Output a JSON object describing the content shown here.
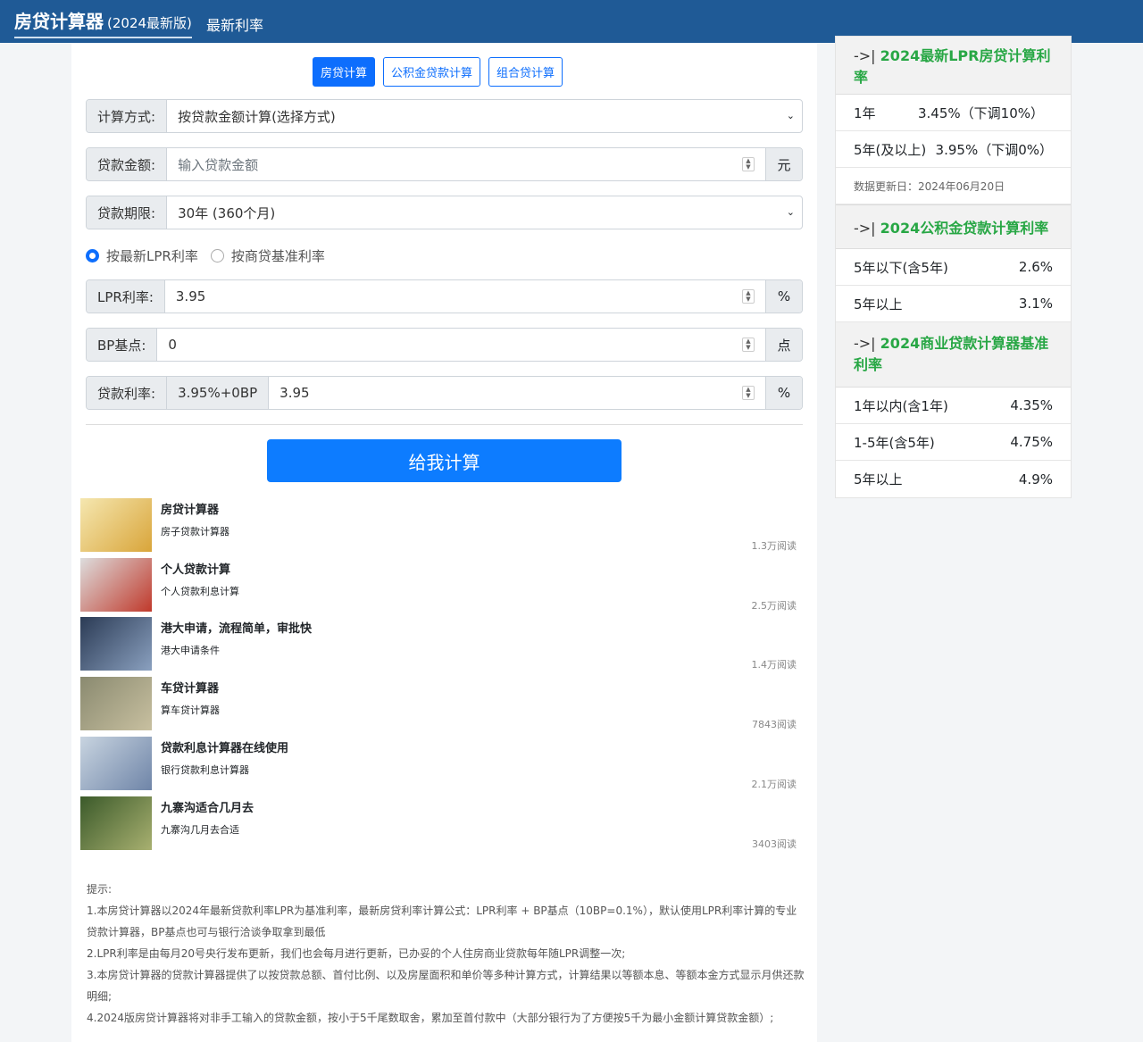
{
  "header": {
    "title": "房贷计算器",
    "version": "(2024最新版)",
    "link": "最新利率"
  },
  "tabs": [
    "房贷计算",
    "公积金贷款计算",
    "组合贷计算"
  ],
  "form": {
    "method_label": "计算方式:",
    "method_value": "按贷款金额计算(选择方式)",
    "amount_label": "贷款金额:",
    "amount_placeholder": "输入贷款金额",
    "amount_unit": "元",
    "term_label": "贷款期限:",
    "term_value": "30年 (360个月)",
    "radio_lpr": "按最新LPR利率",
    "radio_base": "按商贷基准利率",
    "lpr_label": "LPR利率:",
    "lpr_value": "3.95",
    "pct": "%",
    "bp_label": "BP基点:",
    "bp_value": "0",
    "bp_unit": "点",
    "rate_label": "贷款利率:",
    "rate_formula": "3.95%+0BP",
    "rate_value": "3.95",
    "submit": "给我计算"
  },
  "articles": [
    {
      "title": "房贷计算器",
      "sub": "房子贷款计算器",
      "reads": "1.3万阅读"
    },
    {
      "title": "个人贷款计算",
      "sub": "个人贷款利息计算",
      "reads": "2.5万阅读"
    },
    {
      "title": "港大申请，流程简单，审批快",
      "sub": "港大申请条件",
      "reads": "1.4万阅读"
    },
    {
      "title": "车贷计算器",
      "sub": "算车贷计算器",
      "reads": "7843阅读"
    },
    {
      "title": "贷款利息计算器在线使用",
      "sub": "银行贷款利息计算器",
      "reads": "2.1万阅读"
    },
    {
      "title": "九寨沟适合几月去",
      "sub": "九寨沟几月去合适",
      "reads": "3403阅读"
    }
  ],
  "tips": [
    "提示:",
    "1.本房贷计算器以2024年最新贷款利率LPR为基准利率，最新房贷利率计算公式：LPR利率 + BP基点（10BP=0.1%），默认使用LPR利率计算的专业贷款计算器，BP基点也可与银行洽谈争取拿到最低",
    "2.LPR利率是由每月20号央行发布更新，我们也会每月进行更新，已办妥的个人住房商业贷款每年随LPR调整一次;",
    "3.本房贷计算器的贷款计算器提供了以按贷款总额、首付比例、以及房屋面积和单价等多种计算方式，计算结果以等额本息、等额本金方式显示月供还款明细;",
    "4.2024版房贷计算器将对非手工输入的贷款金额，按小于5千尾数取舍，累加至首付款中（大部分银行为了方便按5千为最小金额计算贷款金额）;"
  ],
  "sidebar": {
    "prefix": "->|",
    "lpr": {
      "title": "2024最新LPR房贷计算利率",
      "rows": [
        [
          "1年",
          "3.45%（下调10%）"
        ],
        [
          "5年(及以上)",
          "3.95%（下调0%）"
        ]
      ],
      "note": "数据更新日：2024年06月20日"
    },
    "fund": {
      "title": "2024公积金贷款计算利率",
      "rows": [
        [
          "5年以下(含5年)",
          "2.6%"
        ],
        [
          "5年以上",
          "3.1%"
        ]
      ]
    },
    "biz": {
      "title": "2024商业贷款计算器基准利率",
      "rows": [
        [
          "1年以内(含1年)",
          "4.35%"
        ],
        [
          "1-5年(含5年)",
          "4.75%"
        ],
        [
          "5年以上",
          "4.9%"
        ]
      ]
    }
  }
}
